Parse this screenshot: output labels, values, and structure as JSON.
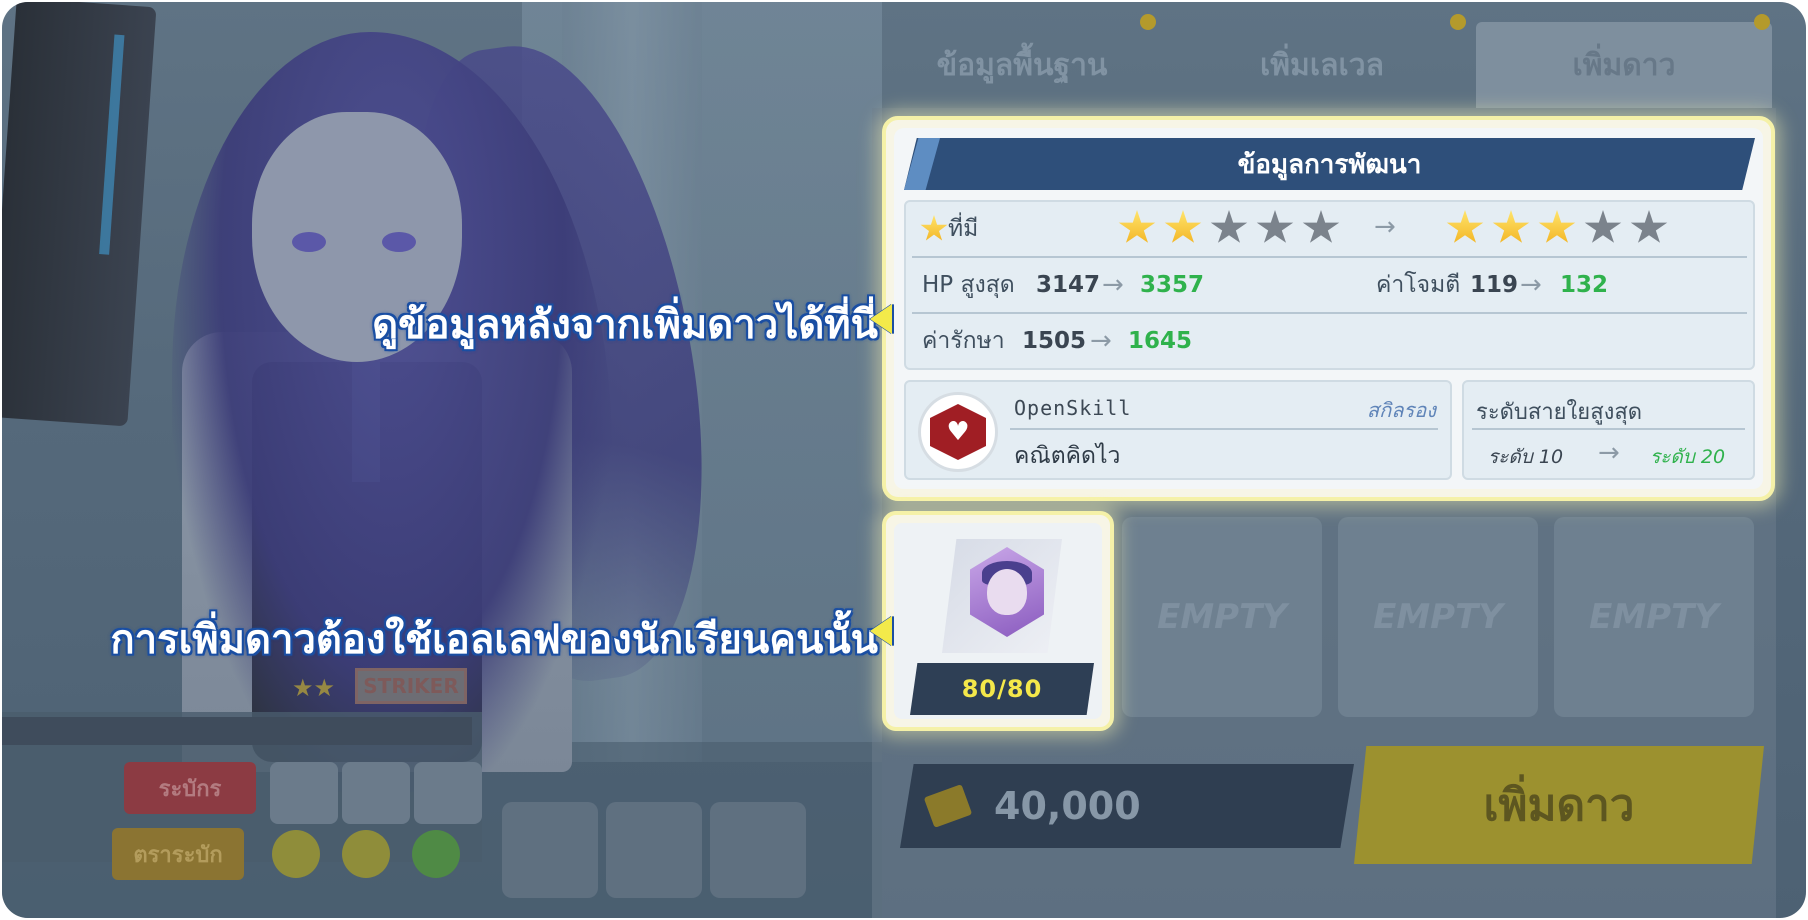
{
  "tabs": [
    "ข้อมูลพื้นฐาน",
    "เพิ่มเลเวล",
    "เพิ่มดาว"
  ],
  "info": {
    "header": "ข้อมูลการพัฒนา",
    "stars_label": "ที่มี",
    "stars_before": 2,
    "stars_after": 3,
    "stars_max": 5,
    "hp_label": "HP สูงสุด",
    "hp_old": "3147",
    "hp_new": "3357",
    "atk_label": "ค่าโจมตี",
    "atk_old": "119",
    "atk_new": "132",
    "heal_label": "ค่ารักษา",
    "heal_old": "1505",
    "heal_new": "1645"
  },
  "skill": {
    "name": "OpenSkill",
    "type": "สกิลรอง",
    "desc": "คณิตคิดไว"
  },
  "bond": {
    "title": "ระดับสายใยสูงสุด",
    "from": "ระดับ 10",
    "to": "ระดับ 20"
  },
  "eleph": {
    "count": "80/80"
  },
  "empty_label": "EMPTY",
  "cost": "40,000",
  "upgrade_button": "เพิ่มดาว",
  "bottom_left": {
    "role": "STRIKER",
    "btn_red": "ระบักร",
    "btn_yellow": "ตราระบัก"
  },
  "callouts": {
    "top": "ดูข้อมูลหลังจากเพิ่มดาวได้ที่นี่",
    "bottom": "การเพิ่มดาวต้องใช้เอลเลฟของนักเรียนคนนั้น"
  },
  "colors": {
    "accent_new_value": "#2fb24c",
    "header_blue": "#2e4f7a",
    "highlight_border": "#f5f1a8",
    "eleph_count": "#f4e84a"
  }
}
